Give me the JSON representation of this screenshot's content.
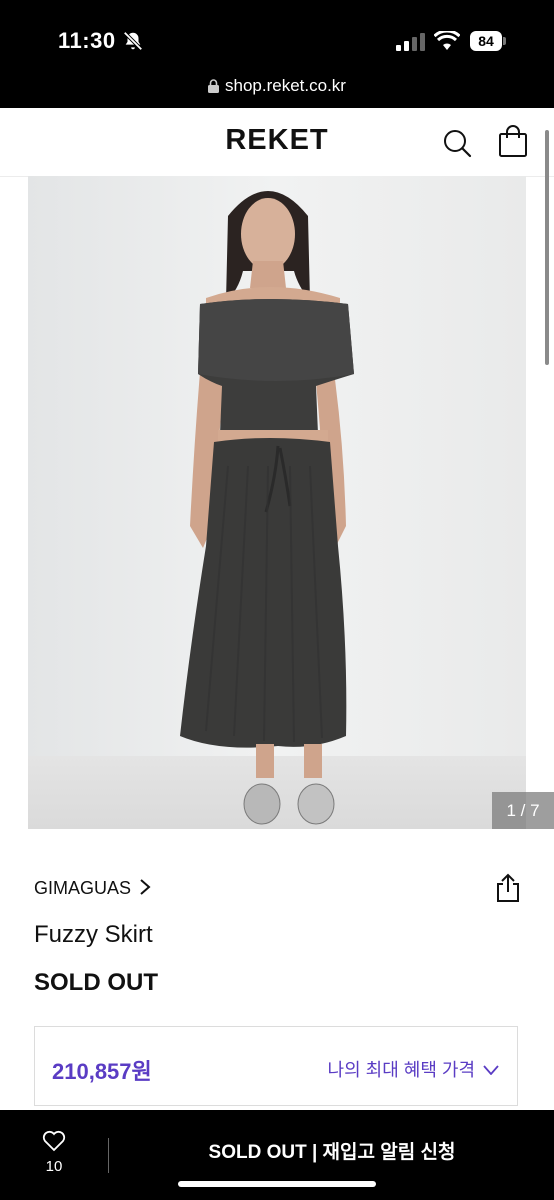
{
  "status_bar": {
    "time": "11:30",
    "battery": "84",
    "url": "shop.reket.co.kr"
  },
  "header": {
    "brand": "REKET"
  },
  "gallery": {
    "counter": "1 / 7"
  },
  "product": {
    "brand": "GIMAGUAS",
    "name": "Fuzzy Skirt",
    "status": "SOLD OUT",
    "price": "210,857원",
    "benefit_label": "나의 최대 혜택 가격"
  },
  "bottom_bar": {
    "like_count": "10",
    "cta_label": "SOLD OUT | 재입고 알림 신청"
  },
  "colors": {
    "accent": "#5a3cc4",
    "background": "#ffffff",
    "bar": "#000000"
  },
  "icons": [
    "bell-off-icon",
    "signal-icon",
    "wifi-icon",
    "battery-icon",
    "lock-icon",
    "search-icon",
    "cart-icon",
    "chevron-right-icon",
    "share-icon",
    "chevron-down-icon",
    "heart-icon"
  ]
}
